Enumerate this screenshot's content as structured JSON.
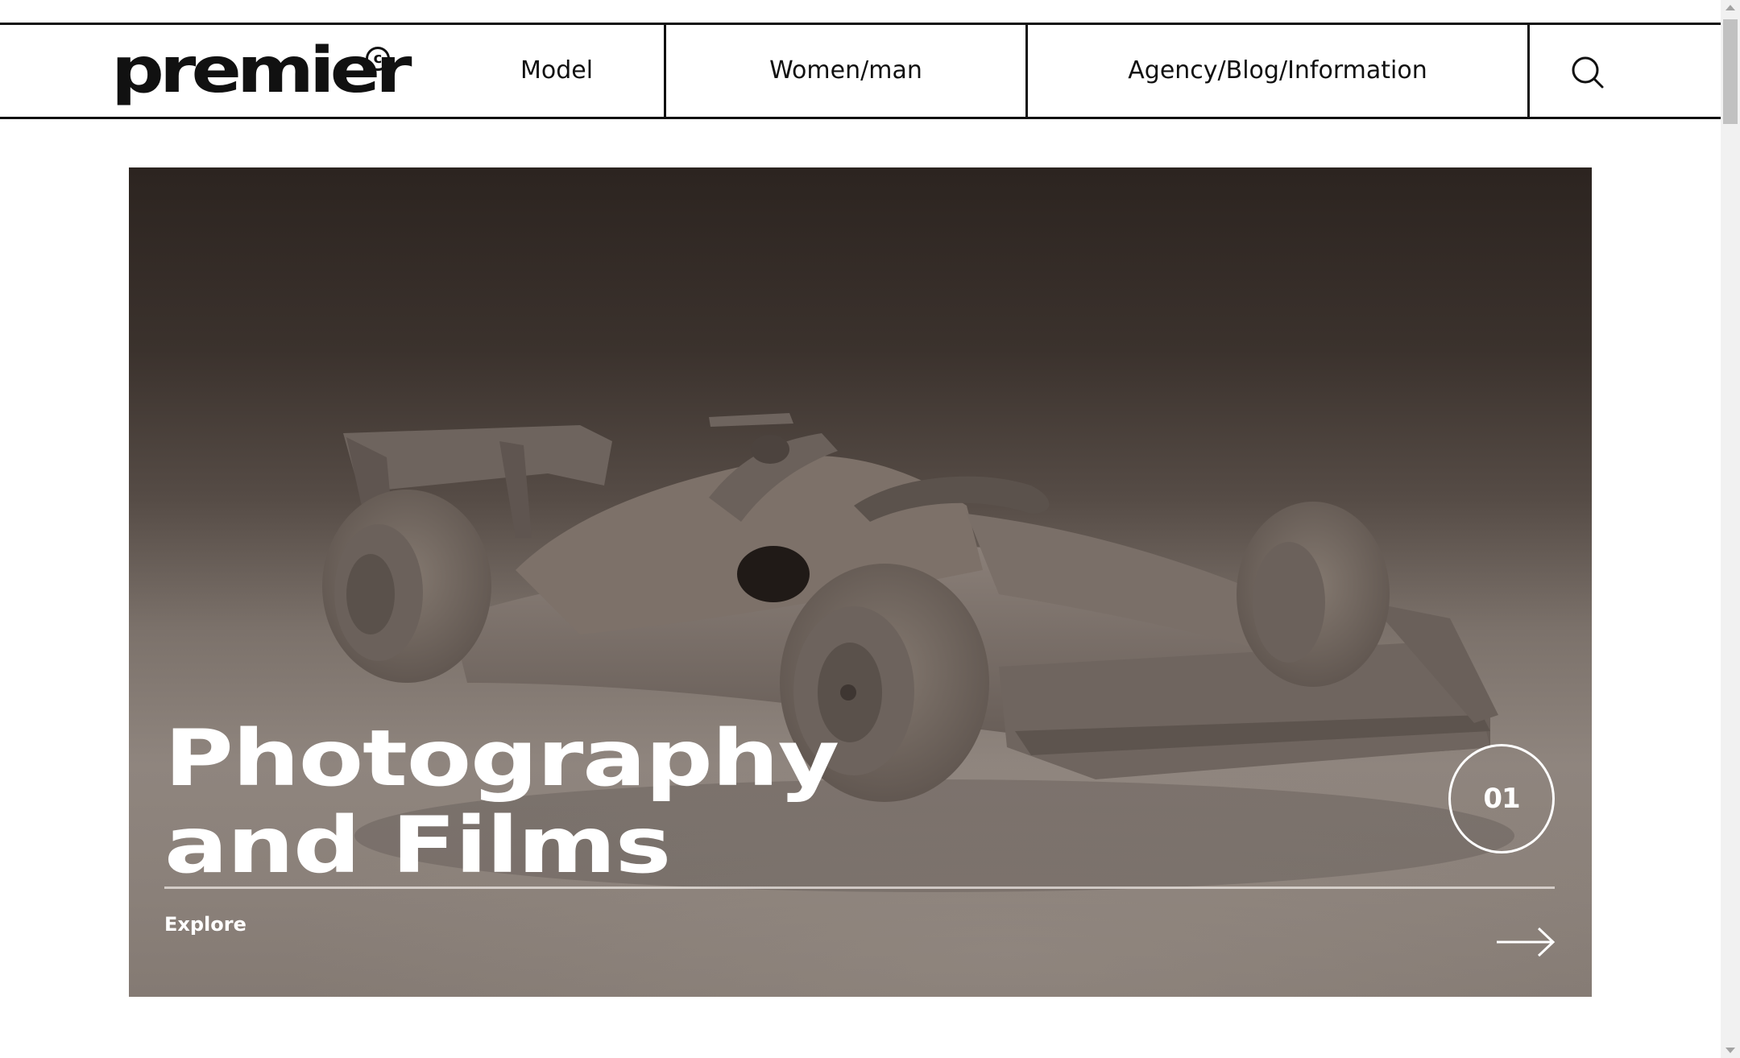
{
  "header": {
    "logo": "premier",
    "logo_mark": "c",
    "nav": {
      "model": "Model",
      "women_man": "Women/man",
      "info": "Agency/Blog/Information"
    },
    "search_icon": "search-icon"
  },
  "hero": {
    "title_line1": "Photography",
    "title_line2": "and Films",
    "number": "01",
    "cta": "Explore",
    "cta_icon": "arrow-right-icon"
  },
  "colors": {
    "ink": "#111111",
    "hero_top": "#2c2420",
    "hero_bottom": "#847a73",
    "car": "#7a6f68"
  }
}
